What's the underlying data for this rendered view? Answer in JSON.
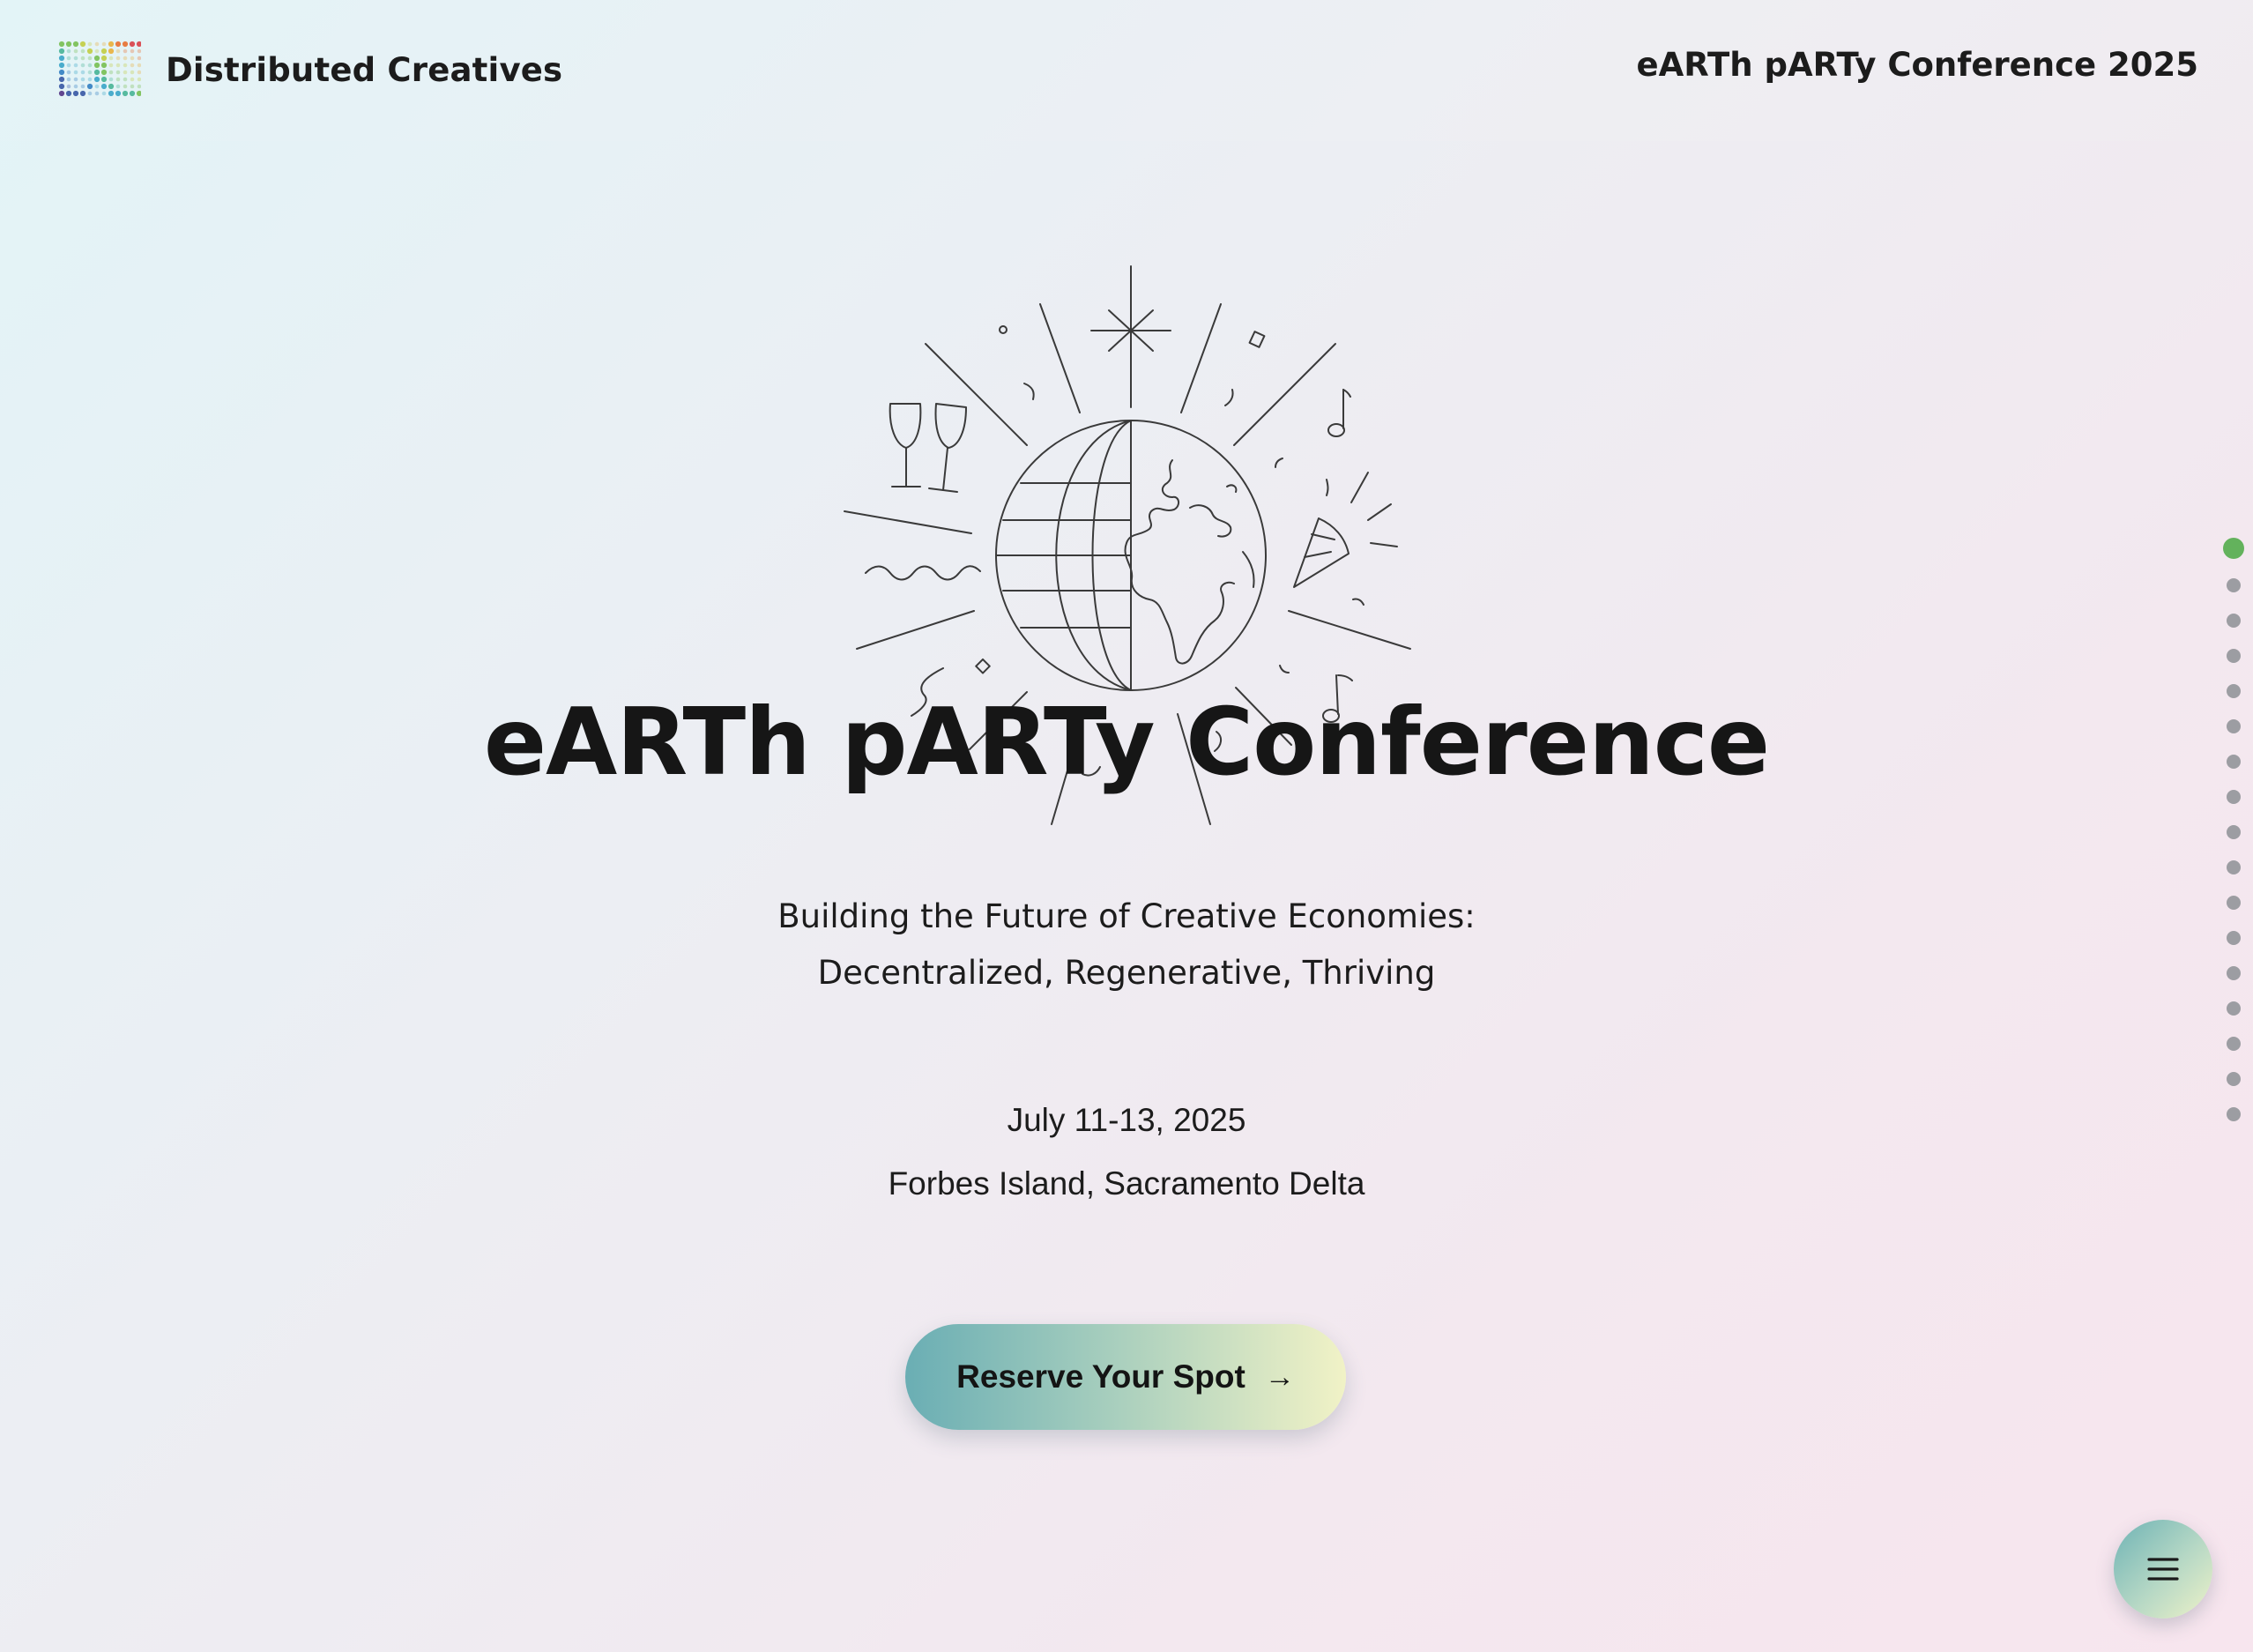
{
  "header": {
    "brand_name": "Distributed Creatives",
    "logo_icon": "dc-dotted-logo",
    "title": "eARTh pARTy Conference 2025"
  },
  "hero": {
    "illustration": "globe-celebration-line-art",
    "title": "eARTh pARTy Conference",
    "subtitle_line1": "Building the Future of Creative Economies:",
    "subtitle_line2": "Decentralized, Regenerative, Thriving",
    "date": "July 11-13, 2025",
    "location": "Forbes Island, Sacramento Delta"
  },
  "cta": {
    "label": "Reserve Your Spot",
    "icon": "arrow-right-icon"
  },
  "section_nav": {
    "total_sections": 17,
    "active_index": 0,
    "active_color": "#63b25c",
    "inactive_color": "#9c9da2"
  },
  "menu_button": {
    "icon": "hamburger-menu-icon"
  },
  "colors": {
    "cta_gradient_start": "#6aaeb4",
    "cta_gradient_end": "#f1f2c6",
    "text": "#151515"
  }
}
